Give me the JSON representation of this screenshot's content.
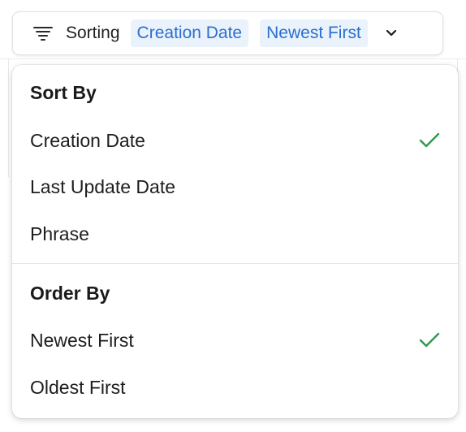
{
  "toolbar": {
    "label": "Sorting",
    "sort_chip": "Creation Date",
    "order_chip": "Newest First",
    "icon": "filter-lines-icon",
    "chevron_icon": "chevron-down-icon"
  },
  "menu": {
    "sort_by": {
      "title": "Sort By",
      "options": [
        {
          "label": "Creation Date",
          "selected": true
        },
        {
          "label": "Last Update Date",
          "selected": false
        },
        {
          "label": "Phrase",
          "selected": false
        }
      ]
    },
    "order_by": {
      "title": "Order By",
      "options": [
        {
          "label": "Newest First",
          "selected": true
        },
        {
          "label": "Oldest First",
          "selected": false
        }
      ]
    }
  },
  "colors": {
    "chip_bg": "#eaf2fb",
    "chip_text": "#2a6fd1",
    "check": "#2e9a4e"
  }
}
